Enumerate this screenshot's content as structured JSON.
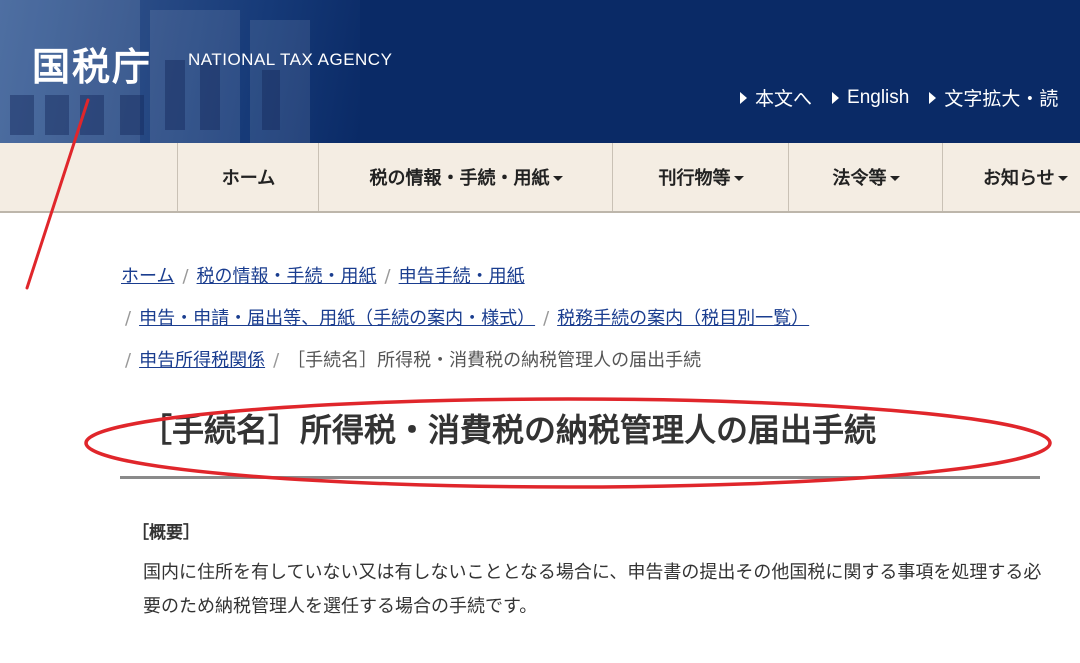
{
  "header": {
    "logo_text": "国税庁",
    "agency_name": "NATIONAL TAX AGENCY",
    "utility_links": [
      {
        "label": "本文へ"
      },
      {
        "label": "English"
      },
      {
        "label": "文字拡大・読"
      }
    ]
  },
  "nav": {
    "items": [
      {
        "label": "ホーム",
        "has_dropdown": false
      },
      {
        "label": "税の情報・手続・用紙",
        "has_dropdown": true
      },
      {
        "label": "刊行物等",
        "has_dropdown": true
      },
      {
        "label": "法令等",
        "has_dropdown": true
      },
      {
        "label": "お知らせ",
        "has_dropdown": true
      }
    ]
  },
  "breadcrumb": {
    "items": [
      {
        "label": "ホーム"
      },
      {
        "label": "税の情報・手続・用紙"
      },
      {
        "label": "申告手続・用紙"
      },
      {
        "label": "申告・申請・届出等、用紙（手続の案内・様式）"
      },
      {
        "label": "税務手続の案内（税目別一覧）"
      },
      {
        "label": "申告所得税関係"
      }
    ],
    "current": "［手続名］所得税・消費税の納税管理人の届出手続",
    "separator": "/"
  },
  "main": {
    "title": "［手続名］所得税・消費税の納税管理人の届出手続",
    "overview_heading": "［概要］",
    "overview_text": "国内に住所を有していない又は有しないこととなる場合に、申告書の提出その他国税に関する事項を処理する必要のため納税管理人を選任する場合の手続です。"
  },
  "colors": {
    "header_bg": "#0a2a66",
    "nav_bg": "#f4ede3",
    "link": "#1a3d8f",
    "annotation_red": "#e0262b"
  }
}
